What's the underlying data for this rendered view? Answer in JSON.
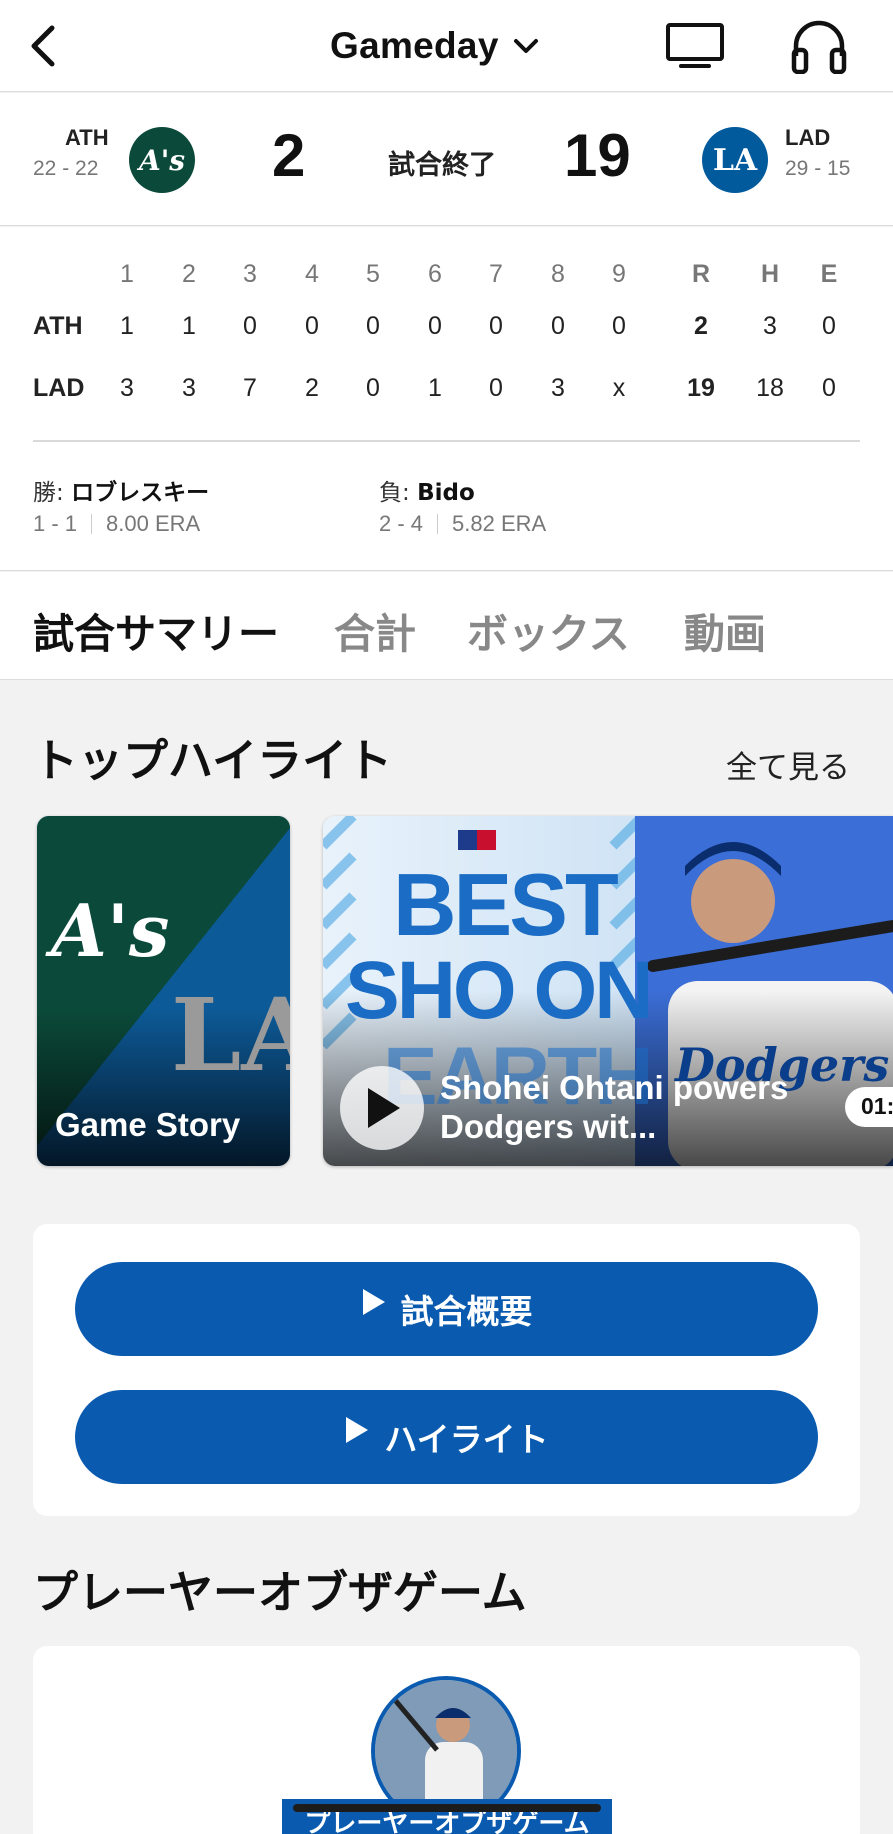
{
  "nav": {
    "title": "Gameday"
  },
  "score": {
    "away": {
      "abbr": "ATH",
      "record": "22 - 22",
      "runs": "2",
      "logo_text": "A's",
      "color": "#0b4a3a"
    },
    "home": {
      "abbr": "LAD",
      "record": "29 - 15",
      "runs": "19",
      "logo_text": "LA",
      "color": "#005a9c"
    },
    "status": "試合終了"
  },
  "linescore": {
    "innings": [
      "1",
      "2",
      "3",
      "4",
      "5",
      "6",
      "7",
      "8",
      "9"
    ],
    "totals_headers": [
      "R",
      "H",
      "E"
    ],
    "rows": [
      {
        "team": "ATH",
        "innings": [
          "1",
          "1",
          "0",
          "0",
          "0",
          "0",
          "0",
          "0",
          "0"
        ],
        "r": "2",
        "h": "3",
        "e": "0"
      },
      {
        "team": "LAD",
        "innings": [
          "3",
          "3",
          "7",
          "2",
          "0",
          "1",
          "0",
          "3",
          "x"
        ],
        "r": "19",
        "h": "18",
        "e": "0"
      }
    ],
    "winning_pitcher": {
      "prefix": "勝:",
      "name": "ロブレスキー",
      "record": "1 - 1",
      "era": "8.00 ERA"
    },
    "losing_pitcher": {
      "prefix": "負:",
      "name": "Bido",
      "record": "2 - 4",
      "era": "5.82 ERA"
    }
  },
  "tabs": [
    "試合サマリー",
    "合計",
    "ボックス",
    "動画"
  ],
  "highlights": {
    "title": "トップハイライト",
    "see_all": "全て見る",
    "story_card": {
      "label": "Game Story",
      "away_logo": "A's",
      "home_logo": "LA"
    },
    "video_card": {
      "title": "Shohei Ohtani powers Dodgers wit...",
      "thumb_text_line1": "BEST",
      "thumb_text_line2": "SHO ON",
      "thumb_text_line3": "EARTH",
      "jersey_text": "Dodgers",
      "duration": "01:"
    }
  },
  "buttons": {
    "summary": "試合概要",
    "highlight": "ハイライト"
  },
  "player_of_game": {
    "title": "プレーヤーオブザゲーム",
    "badge": "プレーヤーオブザゲーム"
  },
  "colors": {
    "accent_blue": "#0a5bb0",
    "ath_green": "#0b4a3a",
    "lad_blue": "#005a9c"
  }
}
